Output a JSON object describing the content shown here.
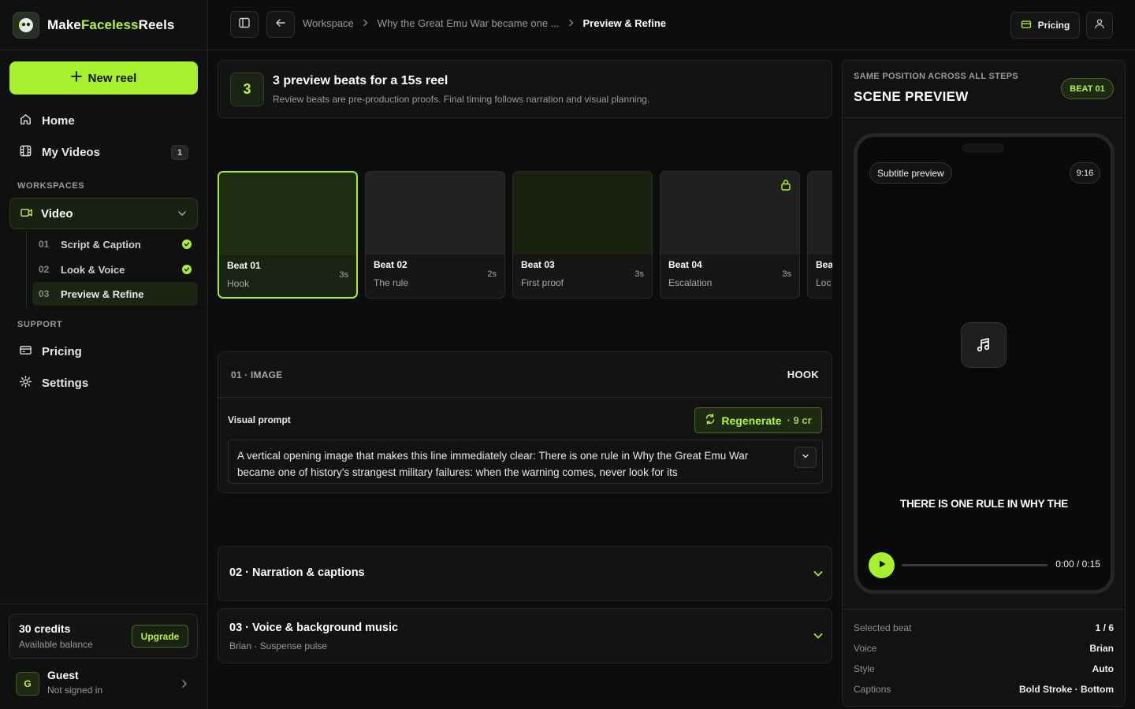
{
  "brand": {
    "name_prefix": "Make",
    "name_accent": "Faceless",
    "name_suffix": "Reels"
  },
  "sidebar": {
    "new_reel": "New reel",
    "nav": [
      {
        "label": "Home",
        "icon": "home-icon"
      },
      {
        "label": "My Videos",
        "icon": "film-icon",
        "badge": "1"
      }
    ],
    "workspaces_label": "WORKSPACES",
    "workspace": {
      "label": "Video",
      "icon": "video-icon"
    },
    "steps": [
      {
        "num": "01",
        "label": "Script & Caption",
        "done": true
      },
      {
        "num": "02",
        "label": "Look & Voice",
        "done": true
      },
      {
        "num": "03",
        "label": "Preview & Refine",
        "active": true
      }
    ],
    "support_label": "SUPPORT",
    "support": [
      {
        "label": "Pricing",
        "icon": "card-icon"
      },
      {
        "label": "Settings",
        "icon": "gear-icon"
      }
    ],
    "credits": {
      "amount": "30 credits",
      "caption": "Available balance",
      "upgrade": "Upgrade"
    },
    "user": {
      "initial": "G",
      "name": "Guest",
      "status": "Not signed in"
    }
  },
  "topbar": {
    "breadcrumb": [
      "Workspace",
      "Why the Great Emu War became one ...",
      "Preview & Refine"
    ],
    "pricing": "Pricing"
  },
  "summary": {
    "count": "3",
    "title": "3 preview beats for a 15s reel",
    "subtitle": "Review beats are pre-production proofs. Final timing follows narration and visual planning."
  },
  "beats": [
    {
      "name": "Beat 01",
      "label": "Hook",
      "duration": "3s",
      "selected": true
    },
    {
      "name": "Beat 02",
      "label": "The rule",
      "duration": "2s"
    },
    {
      "name": "Beat 03",
      "label": "First proof",
      "duration": "3s"
    },
    {
      "name": "Beat 04",
      "label": "Escalation",
      "duration": "3s",
      "locked": true
    },
    {
      "name": "Bea",
      "label": "Loc",
      "duration": ""
    }
  ],
  "image_section": {
    "heading": "01 · IMAGE",
    "tag": "HOOK",
    "prompt_label": "Visual prompt",
    "regenerate": "Regenerate",
    "regenerate_cost": "· 9 cr",
    "prompt": "A vertical opening image that makes this line immediately clear: There is one rule in Why the Great Emu War became one of history's strangest military failures: when the warning comes, never look for its"
  },
  "accordions": [
    {
      "title": "02 · Narration & captions",
      "subtitle": ""
    },
    {
      "title": "03 · Voice & background music",
      "subtitle": "Brian · Suspense pulse"
    }
  ],
  "preview": {
    "eyebrow": "SAME POSITION ACROSS ALL STEPS",
    "title": "SCENE PREVIEW",
    "beat_pill": "BEAT 01",
    "subtitle_pill": "Subtitle preview",
    "ratio": "9:16",
    "caption": "THERE IS ONE RULE IN WHY THE",
    "time": "0:00 / 0:15",
    "details": [
      {
        "key": "Selected beat",
        "value": "1 / 6"
      },
      {
        "key": "Voice",
        "value": "Brian"
      },
      {
        "key": "Style",
        "value": "Auto"
      },
      {
        "key": "Captions",
        "value": "Bold Stroke · Bottom"
      }
    ]
  },
  "colors": {
    "accent": "#a6f02e",
    "background": "#0d0d0d",
    "panel": "#131313"
  }
}
